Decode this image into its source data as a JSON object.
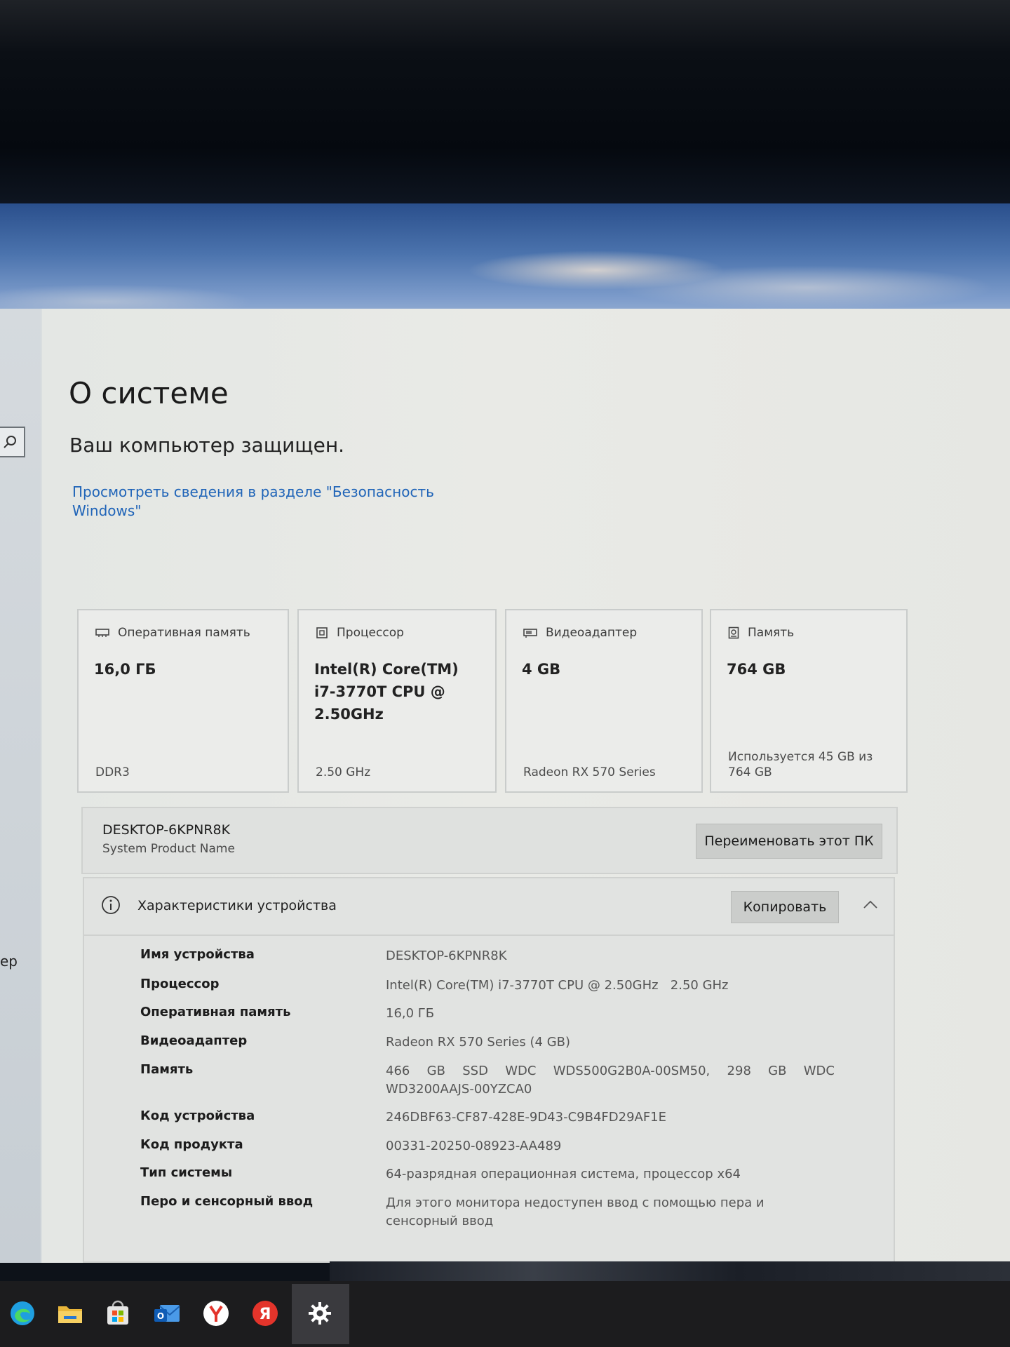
{
  "page": {
    "title": "О системе",
    "protection_status": "Ваш компьютер защищен.",
    "security_link": "Просмотреть сведения в разделе \"Безопасность Windows\"",
    "nav_fragment": "ер"
  },
  "cards": [
    {
      "label": "Оперативная память",
      "value": "16,0 ГБ",
      "sub": "DDR3",
      "icon": "ram-icon"
    },
    {
      "label": "Процессор",
      "value": "Intel(R) Core(TM) i7-3770T CPU @ 2.50GHz",
      "sub": "2.50 GHz",
      "icon": "cpu-icon"
    },
    {
      "label": "Видеоадаптер",
      "value": "4 GB",
      "sub": "Radeon RX 570 Series",
      "icon": "gpu-icon"
    },
    {
      "label": "Память",
      "value": "764 GB",
      "sub": "Используется 45 GB из 764 GB",
      "icon": "storage-icon"
    }
  ],
  "device": {
    "name": "DESKTOP-6KPNR8K",
    "model": "System Product Name",
    "rename_button": "Переименовать этот ПК"
  },
  "specs": {
    "title": "Характеристики устройства",
    "copy_button": "Копировать",
    "rows": [
      {
        "label": "Имя устройства",
        "value": "DESKTOP-6KPNR8K"
      },
      {
        "label": "Процессор",
        "value": "Intel(R) Core(TM) i7-3770T CPU @ 2.50GHz   2.50 GHz"
      },
      {
        "label": "Оперативная память",
        "value": "16,0 ГБ"
      },
      {
        "label": "Видеоадаптер",
        "value": "Radeon RX 570 Series (4 GB)"
      },
      {
        "label": "Память",
        "value": "466 GB SSD WDC WDS500G2B0A-00SM50, 298 GB WDC WD3200AAJS-00YZCA0"
      },
      {
        "label": "Код устройства",
        "value": "246DBF63-CF87-428E-9D43-C9B4FD29AF1E"
      },
      {
        "label": "Код продукта",
        "value": "00331-20250-08923-AA489"
      },
      {
        "label": "Тип системы",
        "value": "64-разрядная операционная система, процессор x64"
      },
      {
        "label": "Перо и сенсорный ввод",
        "value": "Для этого монитора недоступен ввод с помощью пера и сенсорный ввод"
      }
    ]
  },
  "taskbar": {
    "items": [
      {
        "name": "edge-icon",
        "color": "#1f9fe0"
      },
      {
        "name": "file-explorer-icon",
        "color": "#f0c040"
      },
      {
        "name": "store-icon",
        "color": "#3a8ee0"
      },
      {
        "name": "mail-icon",
        "color": "#2a6fd0"
      },
      {
        "name": "yandex-browser-icon",
        "color": "#ffffff"
      },
      {
        "name": "yandex-icon",
        "color": "#e3342b"
      },
      {
        "name": "settings-gear-icon",
        "color": "#ffffff"
      }
    ]
  },
  "colors": {
    "link": "#1f64b8",
    "accent_button": "#cbcdcb"
  }
}
